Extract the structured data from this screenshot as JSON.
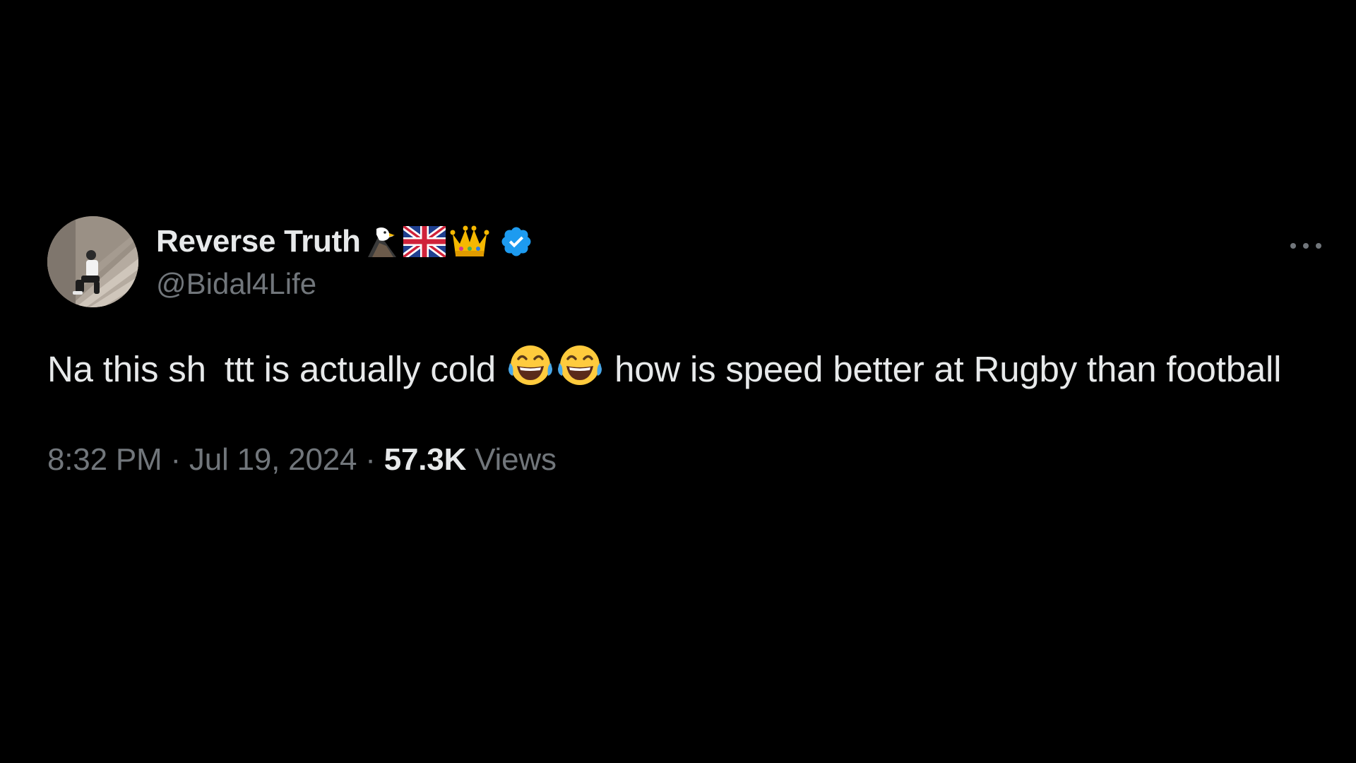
{
  "author": {
    "display_name": "Reverse Truth",
    "handle": "@Bidal4Life",
    "name_emojis": [
      "eagle-emoji",
      "uk-flag-emoji",
      "crown-emoji"
    ],
    "verified_color": "#1d9bf0"
  },
  "tweet": {
    "text_part1": "Na this sh",
    "text_part2": "ttt is actually cold",
    "text_part3": "how is speed better at Rugby than football",
    "emojis": [
      "tears-of-joy-emoji",
      "tears-of-joy-emoji"
    ]
  },
  "meta": {
    "time": "8:32 PM",
    "separator": "·",
    "date": "Jul 19, 2024",
    "views_count": "57.3K",
    "views_label": "Views"
  },
  "colors": {
    "background": "#000000",
    "primary_text": "#e7e9ea",
    "secondary_text": "#71767b"
  }
}
